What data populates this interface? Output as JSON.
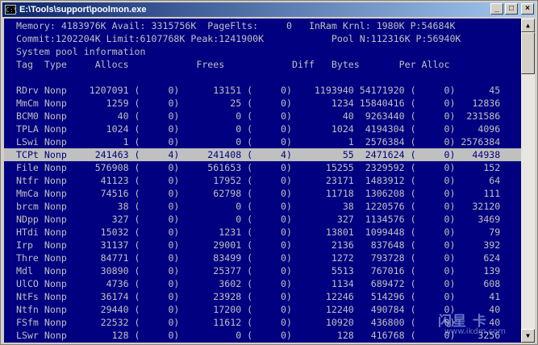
{
  "window": {
    "title": "E:\\Tools\\support\\poolmon.exe",
    "minimize_glyph": "_",
    "maximize_glyph": "□",
    "close_glyph": "×"
  },
  "header_lines": [
    " Memory: 4183976K Avail: 3315756K  PageFlts:     0   InRam Krnl: 1980K P:54684K",
    " Commit:1202204K Limit:6107768K Peak:1241900K            Pool N:112316K P:56940K",
    " System pool information",
    " Tag  Type     Allocs            Frees            Diff   Bytes       Per Alloc",
    " "
  ],
  "rows": [
    {
      "tag": "RDrv",
      "type": "Nonp",
      "allocs": "1207091",
      "alloc_diff": "0",
      "frees": "13151",
      "free_diff": "0",
      "diff": "1193940",
      "bytes": "54171920",
      "bytes_diff": "0",
      "per_alloc": "45"
    },
    {
      "tag": "MmCm",
      "type": "Nonp",
      "allocs": "1259",
      "alloc_diff": "0",
      "frees": "25",
      "free_diff": "0",
      "diff": "1234",
      "bytes": "15840416",
      "bytes_diff": "0",
      "per_alloc": "12836"
    },
    {
      "tag": "BCM0",
      "type": "Nonp",
      "allocs": "40",
      "alloc_diff": "0",
      "frees": "0",
      "free_diff": "0",
      "diff": "40",
      "bytes": "9263440",
      "bytes_diff": "0",
      "per_alloc": "231586"
    },
    {
      "tag": "TPLA",
      "type": "Nonp",
      "allocs": "1024",
      "alloc_diff": "0",
      "frees": "0",
      "free_diff": "0",
      "diff": "1024",
      "bytes": "4194304",
      "bytes_diff": "0",
      "per_alloc": "4096"
    },
    {
      "tag": "LSwi",
      "type": "Nonp",
      "allocs": "1",
      "alloc_diff": "0",
      "frees": "0",
      "free_diff": "0",
      "diff": "1",
      "bytes": "2576384",
      "bytes_diff": "0",
      "per_alloc": "2576384"
    },
    {
      "tag": "TCPt",
      "type": "Nonp",
      "allocs": "241463",
      "alloc_diff": "4",
      "frees": "241408",
      "free_diff": "4",
      "diff": "55",
      "bytes": "2471624",
      "bytes_diff": "0",
      "per_alloc": "44938",
      "highlight": true
    },
    {
      "tag": "File",
      "type": "Nonp",
      "allocs": "576908",
      "alloc_diff": "0",
      "frees": "561653",
      "free_diff": "0",
      "diff": "15255",
      "bytes": "2329592",
      "bytes_diff": "0",
      "per_alloc": "152"
    },
    {
      "tag": "Ntfr",
      "type": "Nonp",
      "allocs": "41123",
      "alloc_diff": "0",
      "frees": "17952",
      "free_diff": "0",
      "diff": "23171",
      "bytes": "1483912",
      "bytes_diff": "0",
      "per_alloc": "64"
    },
    {
      "tag": "MmCa",
      "type": "Nonp",
      "allocs": "74516",
      "alloc_diff": "0",
      "frees": "62798",
      "free_diff": "0",
      "diff": "11718",
      "bytes": "1306208",
      "bytes_diff": "0",
      "per_alloc": "111"
    },
    {
      "tag": "brcm",
      "type": "Nonp",
      "allocs": "38",
      "alloc_diff": "0",
      "frees": "0",
      "free_diff": "0",
      "diff": "38",
      "bytes": "1220576",
      "bytes_diff": "0",
      "per_alloc": "32120"
    },
    {
      "tag": "NDpp",
      "type": "Nonp",
      "allocs": "327",
      "alloc_diff": "0",
      "frees": "0",
      "free_diff": "0",
      "diff": "327",
      "bytes": "1134576",
      "bytes_diff": "0",
      "per_alloc": "3469"
    },
    {
      "tag": "HTdi",
      "type": "Nonp",
      "allocs": "15032",
      "alloc_diff": "0",
      "frees": "1231",
      "free_diff": "0",
      "diff": "13801",
      "bytes": "1099448",
      "bytes_diff": "0",
      "per_alloc": "79"
    },
    {
      "tag": "Irp ",
      "type": "Nonp",
      "allocs": "31137",
      "alloc_diff": "0",
      "frees": "29001",
      "free_diff": "0",
      "diff": "2136",
      "bytes": "837648",
      "bytes_diff": "0",
      "per_alloc": "392"
    },
    {
      "tag": "Thre",
      "type": "Nonp",
      "allocs": "84771",
      "alloc_diff": "0",
      "frees": "83499",
      "free_diff": "0",
      "diff": "1272",
      "bytes": "793728",
      "bytes_diff": "0",
      "per_alloc": "624"
    },
    {
      "tag": "Mdl ",
      "type": "Nonp",
      "allocs": "30890",
      "alloc_diff": "0",
      "frees": "25377",
      "free_diff": "0",
      "diff": "5513",
      "bytes": "767016",
      "bytes_diff": "0",
      "per_alloc": "139"
    },
    {
      "tag": "UlCO",
      "type": "Nonp",
      "allocs": "4736",
      "alloc_diff": "0",
      "frees": "3602",
      "free_diff": "0",
      "diff": "1134",
      "bytes": "689472",
      "bytes_diff": "0",
      "per_alloc": "608"
    },
    {
      "tag": "NtFs",
      "type": "Nonp",
      "allocs": "36174",
      "alloc_diff": "0",
      "frees": "23928",
      "free_diff": "0",
      "diff": "12246",
      "bytes": "514296",
      "bytes_diff": "0",
      "per_alloc": "41"
    },
    {
      "tag": "Ntfn",
      "type": "Nonp",
      "allocs": "29440",
      "alloc_diff": "0",
      "frees": "17200",
      "free_diff": "0",
      "diff": "12240",
      "bytes": "490784",
      "bytes_diff": "0",
      "per_alloc": "40"
    },
    {
      "tag": "FSfm",
      "type": "Nonp",
      "allocs": "22532",
      "alloc_diff": "0",
      "frees": "11612",
      "free_diff": "0",
      "diff": "10920",
      "bytes": "436800",
      "bytes_diff": "0",
      "per_alloc": "40"
    },
    {
      "tag": "LSwr",
      "type": "Nonp",
      "allocs": "128",
      "alloc_diff": "0",
      "frees": "0",
      "free_diff": "0",
      "diff": "128",
      "bytes": "416768",
      "bytes_diff": "0",
      "per_alloc": "3256"
    }
  ],
  "watermark": {
    "text_big": "闪星 卡",
    "text_small": "www.ikdm.com"
  },
  "colors": {
    "console_bg": "#000080",
    "console_fg": "#c0c0c0",
    "highlight_bg": "#c0c0c0",
    "highlight_fg": "#000080"
  }
}
